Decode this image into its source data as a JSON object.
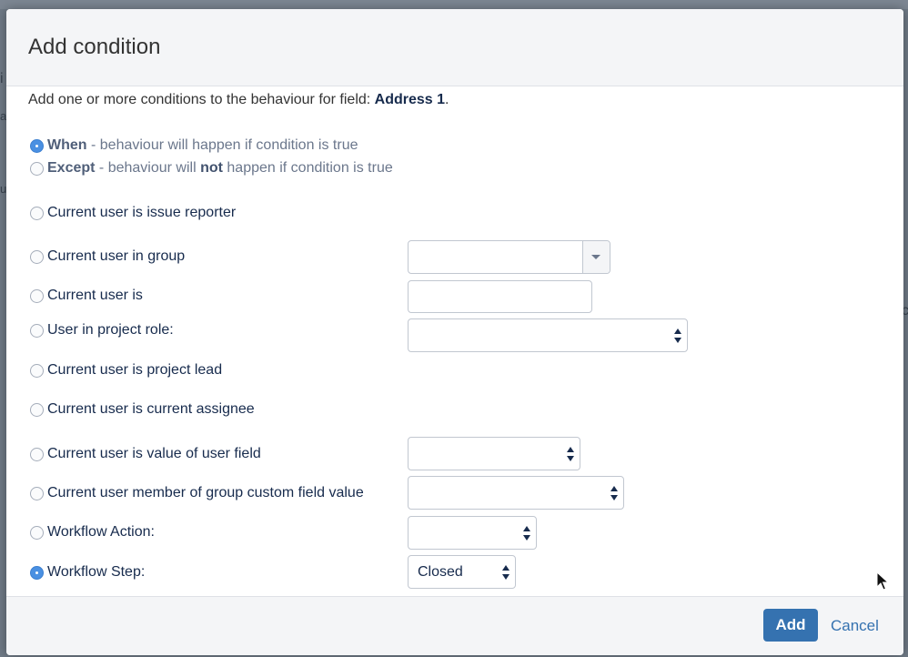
{
  "dialog": {
    "title": "Add condition",
    "intro_prefix": "Add one or more conditions to the behaviour for field: ",
    "field_name": "Address 1",
    "intro_suffix": "."
  },
  "mode": {
    "when": {
      "bold": "When",
      "text": " - behaviour will happen if condition is true",
      "checked": true
    },
    "except": {
      "bold": "Except",
      "text_before": " - behaviour will ",
      "emphasis": "not",
      "text_after": " happen if condition is true",
      "checked": false
    }
  },
  "conditions": {
    "issue_reporter": {
      "label": "Current user is issue reporter",
      "checked": false
    },
    "in_group": {
      "label": "Current user in group",
      "checked": false,
      "value": ""
    },
    "user_is": {
      "label": "Current user is",
      "checked": false,
      "value": ""
    },
    "project_role": {
      "label": "User in project role:",
      "checked": false,
      "value": ""
    },
    "project_lead": {
      "label": "Current user is project lead",
      "checked": false
    },
    "current_assignee": {
      "label": "Current user is current assignee",
      "checked": false
    },
    "user_field": {
      "label": "Current user is value of user field",
      "checked": false,
      "value": ""
    },
    "group_custom_field": {
      "label": "Current user member of group custom field value",
      "checked": false,
      "value": ""
    },
    "workflow_action": {
      "label": "Workflow Action:",
      "checked": false,
      "value": ""
    },
    "workflow_step": {
      "label": "Workflow Step:",
      "checked": true,
      "value": "Closed"
    }
  },
  "footer": {
    "add_label": "Add",
    "cancel_label": "Cancel"
  },
  "colors": {
    "primary": "#3572b0",
    "radio_checked": "#4a90e2",
    "header_bg": "#f4f5f7",
    "overlay": "#6f7a86"
  }
}
